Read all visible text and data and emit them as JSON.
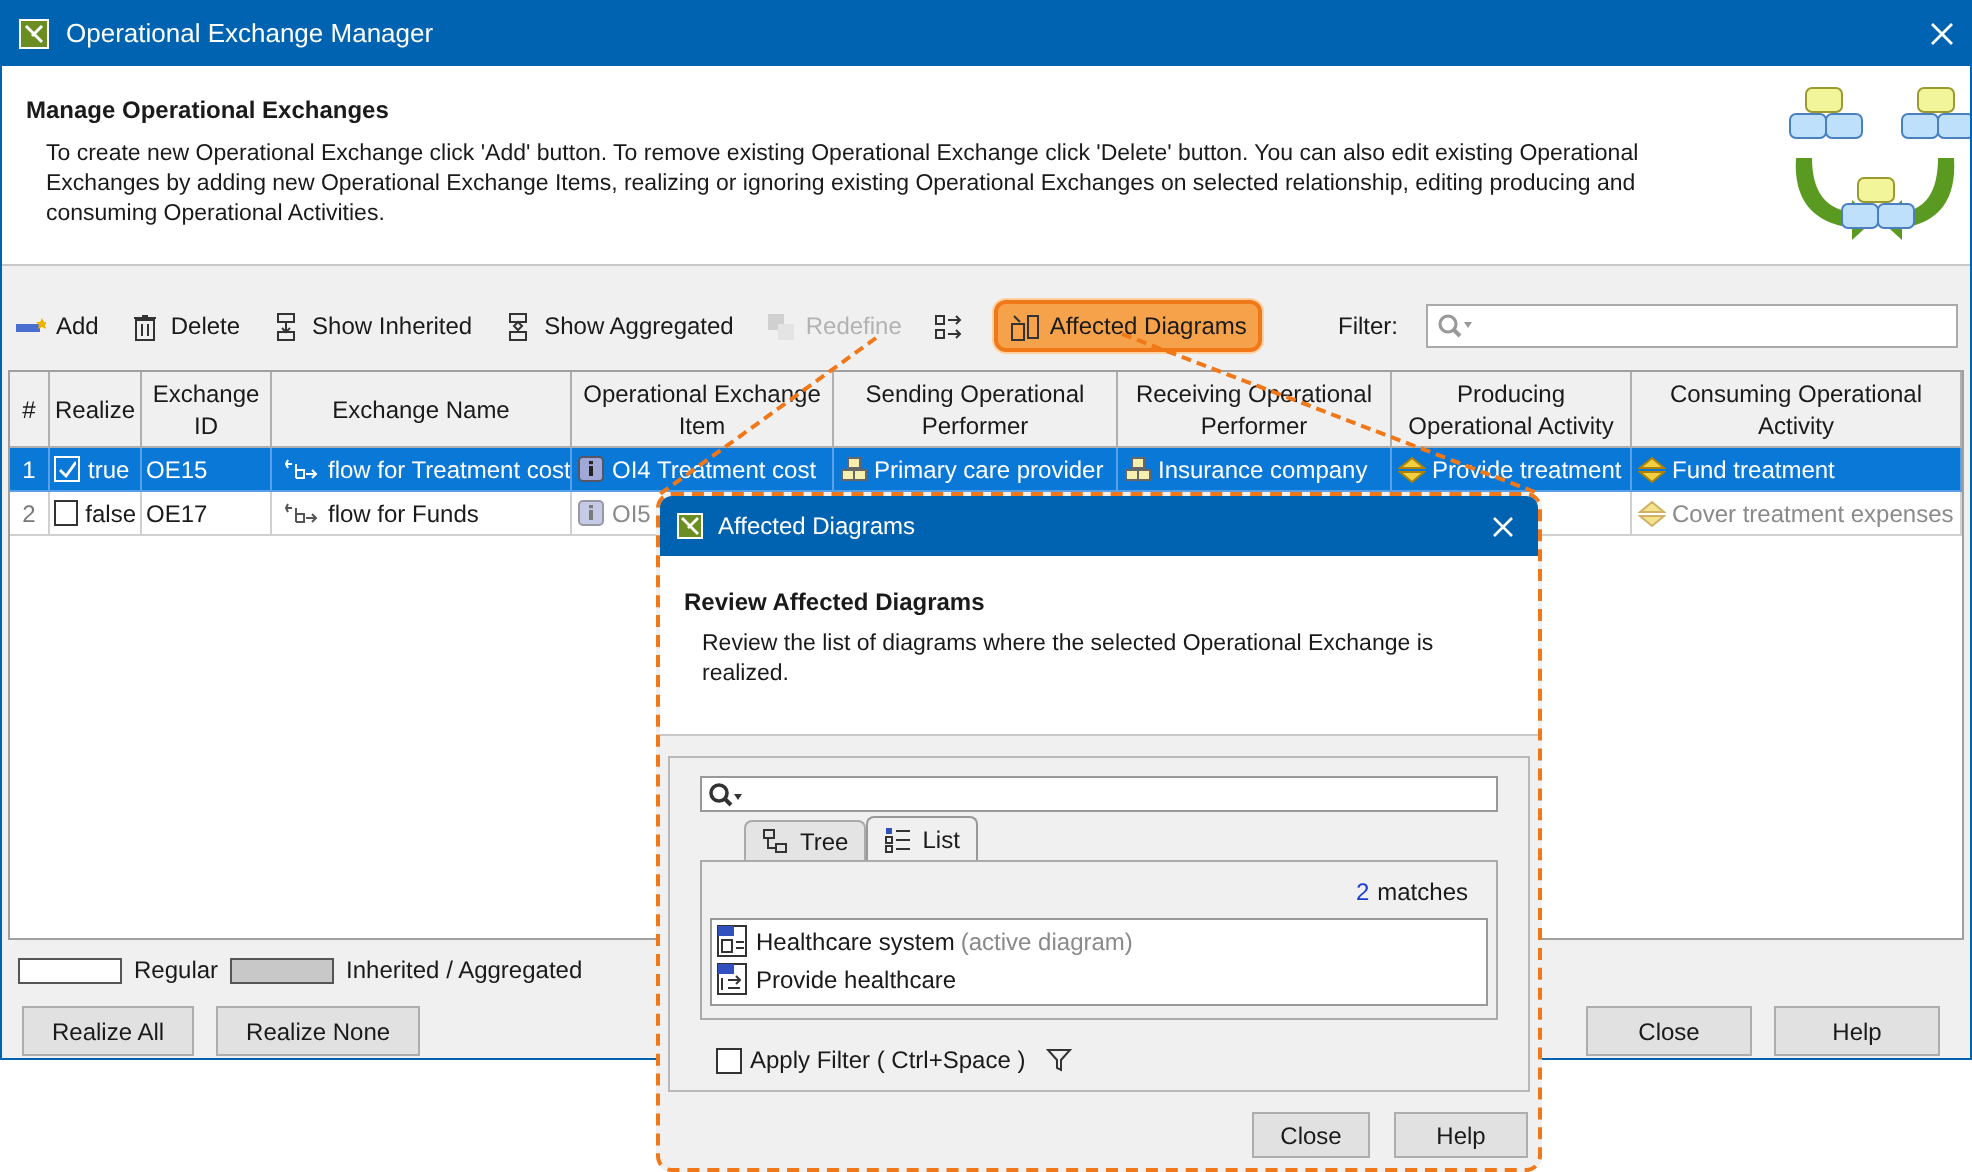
{
  "window": {
    "title": "Operational Exchange Manager"
  },
  "header": {
    "heading": "Manage Operational Exchanges",
    "description": "To create new Operational Exchange click 'Add' button. To remove existing Operational Exchange click 'Delete' button. You can also edit existing Operational Exchanges by adding new Operational Exchange Items, realizing or ignoring existing Operational Exchanges on selected relationship, editing producing and consuming Operational Activities."
  },
  "toolbar": {
    "buttons": [
      {
        "kind": "add",
        "label": "Add",
        "disabled": false,
        "highlighted": false
      },
      {
        "kind": "delete",
        "label": "Delete",
        "disabled": false,
        "highlighted": false
      },
      {
        "kind": "inherited",
        "label": "Show Inherited",
        "disabled": false,
        "highlighted": false
      },
      {
        "kind": "aggregated",
        "label": "Show Aggregated",
        "disabled": false,
        "highlighted": false
      },
      {
        "kind": "redefine",
        "label": "Redefine",
        "disabled": true,
        "highlighted": false
      },
      {
        "kind": "swap",
        "disabled": false,
        "highlighted": false
      },
      {
        "kind": "diagrams",
        "label": "Affected Diagrams",
        "disabled": false,
        "highlighted": true
      }
    ],
    "filter_label": "Filter:"
  },
  "table": {
    "columns": [
      "#",
      "Realize",
      "Exchange ID",
      "Exchange Name",
      "Operational Exchange Item",
      "Sending Operational Performer",
      "Receiving Operational Performer",
      "Producing Operational Activity",
      "Consuming Operational Activity"
    ],
    "rows": [
      {
        "selected": true,
        "number": "1",
        "realized": true,
        "realize_label": "true",
        "id": "OE15",
        "name": "flow for Treatment cost",
        "item": {
          "text": "OI4 Treatment cost",
          "dimmed": false
        },
        "sending": {
          "text": "Primary care provider",
          "dimmed": false
        },
        "receiving": {
          "text": "Insurance company",
          "dimmed": false
        },
        "producing": {
          "text": "Provide treatment",
          "dimmed": false
        },
        "consuming": {
          "text": "Fund treatment",
          "dimmed": false
        }
      },
      {
        "selected": false,
        "number": "2",
        "realized": false,
        "realize_label": "false",
        "id": "OE17",
        "name": "flow for Funds",
        "item": {
          "text": "OI5",
          "dimmed": true
        },
        "consuming": {
          "text": "Cover treatment expenses",
          "dimmed": true
        }
      }
    ]
  },
  "legend": [
    {
      "kind": "regular",
      "label": "Regular"
    },
    {
      "kind": "inherited",
      "label": "Inherited / Aggregated"
    }
  ],
  "buttons_left": [
    "Realize All",
    "Realize None"
  ],
  "buttons_right": [
    "Close",
    "Help"
  ],
  "dialog": {
    "title": "Affected Diagrams",
    "heading": "Review Affected Diagrams",
    "description": "Review the list of diagrams where the selected Operational Exchange is realized.",
    "tabs": [
      {
        "label": "Tree",
        "selected": false
      },
      {
        "label": "List",
        "selected": true
      }
    ],
    "match_count": "2",
    "match_label": "matches",
    "items": [
      {
        "kind": "system",
        "name": "Healthcare system",
        "note": "(active diagram)"
      },
      {
        "kind": "activity",
        "name": "Provide healthcare"
      }
    ],
    "apply_filter": {
      "label": "Apply Filter ( Ctrl+Space )",
      "checked": false
    },
    "buttons": [
      "Close",
      "Help"
    ]
  }
}
